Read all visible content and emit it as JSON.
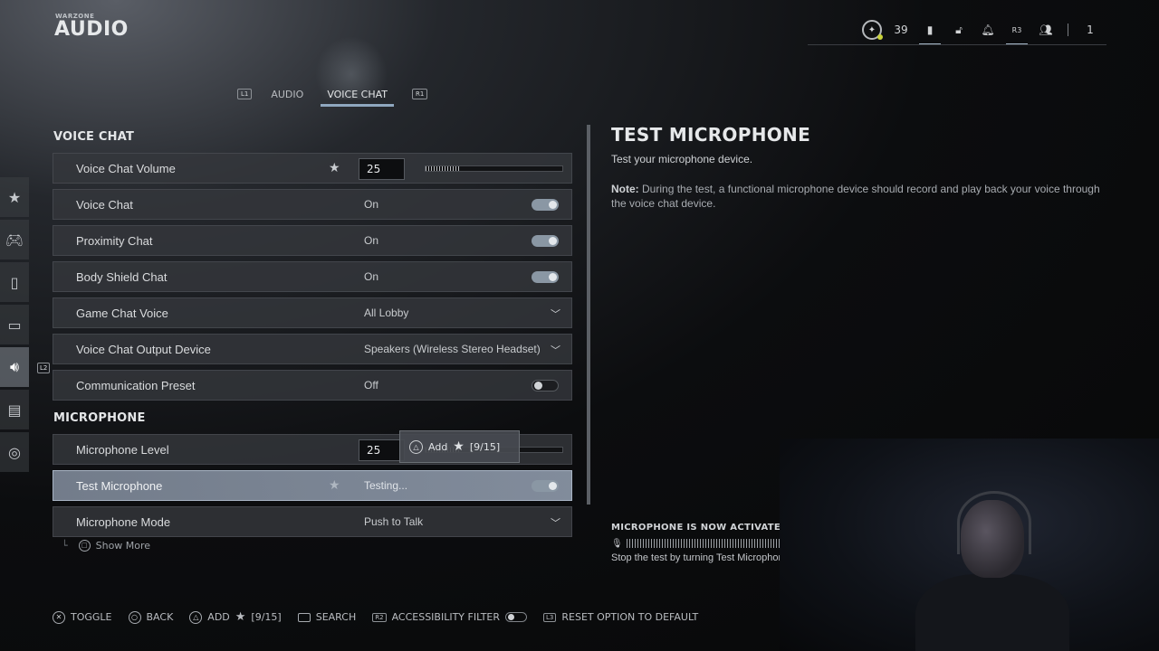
{
  "header": {
    "game_logo": "WARZONE",
    "title": "AUDIO"
  },
  "topbar": {
    "level": "39",
    "r3_hint": "R3",
    "party_count": "1"
  },
  "tabs": {
    "left_hint": "L1",
    "right_hint": "R1",
    "items": [
      {
        "label": "AUDIO",
        "active": false
      },
      {
        "label": "VOICE CHAT",
        "active": true
      }
    ]
  },
  "rail": {
    "hint": "L2",
    "icons": [
      "star-icon",
      "gamepad-icon",
      "mouse-icon",
      "display-icon",
      "speaker-icon",
      "interface-icon",
      "network-icon"
    ],
    "active_index": 4
  },
  "voice_chat": {
    "section_title": "VOICE CHAT",
    "volume": {
      "label": "Voice Chat Volume",
      "value": "25",
      "level": 0.25
    },
    "voice_chat": {
      "label": "Voice Chat",
      "value": "On"
    },
    "proximity_chat": {
      "label": "Proximity Chat",
      "value": "On"
    },
    "body_shield_chat": {
      "label": "Body Shield Chat",
      "value": "On"
    },
    "game_chat_voice": {
      "label": "Game Chat Voice",
      "value": "All Lobby"
    },
    "output_device": {
      "label": "Voice Chat Output Device",
      "value": "Speakers (Wireless Stereo Headset)"
    },
    "comm_preset": {
      "label": "Communication Preset",
      "value": "Off"
    }
  },
  "microphone": {
    "section_title": "MICROPHONE",
    "level": {
      "label": "Microphone Level",
      "value": "25",
      "level": 0.25
    },
    "test": {
      "label": "Test Microphone",
      "value": "Testing..."
    },
    "mode": {
      "label": "Microphone Mode",
      "value": "Push to Talk"
    },
    "show_more": "Show More"
  },
  "tooltip": {
    "label": "Add",
    "count": "[9/15]"
  },
  "detail": {
    "title": "TEST MICROPHONE",
    "subtitle": "Test your microphone device.",
    "note_label": "Note:",
    "note_text": "During the test, a functional microphone device should record and play back your voice through the voice chat device.",
    "status": "MICROPHONE IS NOW ACTIVATED FOR TE",
    "stop_text": "Stop the test by turning Test Microphon"
  },
  "footer": {
    "toggle": "TOGGLE",
    "back": "BACK",
    "add": "ADD",
    "add_count": "[9/15]",
    "search": "SEARCH",
    "accessibility_hint": "R2",
    "accessibility": "ACCESSIBILITY FILTER",
    "reset_hint": "L3",
    "reset": "RESET OPTION TO DEFAULT"
  }
}
